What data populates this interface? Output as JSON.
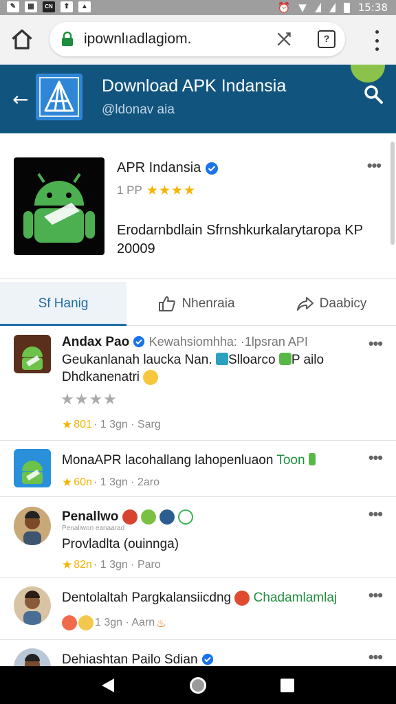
{
  "status_bar": {
    "time": "15:38"
  },
  "browser": {
    "url": "ipownlıadlagiom."
  },
  "header": {
    "title": "Download APK Indansia",
    "handle": "@ldonav aia"
  },
  "app": {
    "name": "APR Indansia",
    "rating_prefix": "1 PP",
    "stars": "★★★★",
    "description": "Erodarnbdlain Sfrnshkurkalarytaropa KP 20009"
  },
  "tabs": [
    {
      "label": "Sf Hanig",
      "icon": "none"
    },
    {
      "label": "Nhenraia",
      "icon": "thumbs-up-icon"
    },
    {
      "label": "Daabicy",
      "icon": "share-icon"
    }
  ],
  "posts": [
    {
      "author": "Andax Pao",
      "title_rest": "Kewahsiomhha: ·1lpsran API",
      "line1": "Geukanlanah laucka Nan.",
      "line1_b": "Slloarco",
      "line1_c": "P ailo",
      "line2": "Dhdkanenatri",
      "stars": "★★★★",
      "meta_star": "★",
      "meta_count": "801",
      "meta_rest": "· 1 3gn · Sarg"
    },
    {
      "author": "MonaAPR",
      "title_rest": "lacohallang lahopenluaon",
      "title_green": "Toon",
      "meta_star": "★",
      "meta_count": "60n",
      "meta_rest": "· 1 3gn · 2aro"
    },
    {
      "author": "Penallwo",
      "sub_small": "Penaliwon eanaarad",
      "line1": "Provladlta (ouinnga)",
      "meta_star": "★",
      "meta_count": "82n",
      "meta_rest": "· 1 3gn · Paro"
    },
    {
      "author": "Dentolaltah Pargkalansiicdng",
      "title_green": "Chadamlamlaj",
      "meta_rest": "1 3gn · Aarn"
    },
    {
      "author": "Dehiashtan Pailo Sdian"
    }
  ]
}
